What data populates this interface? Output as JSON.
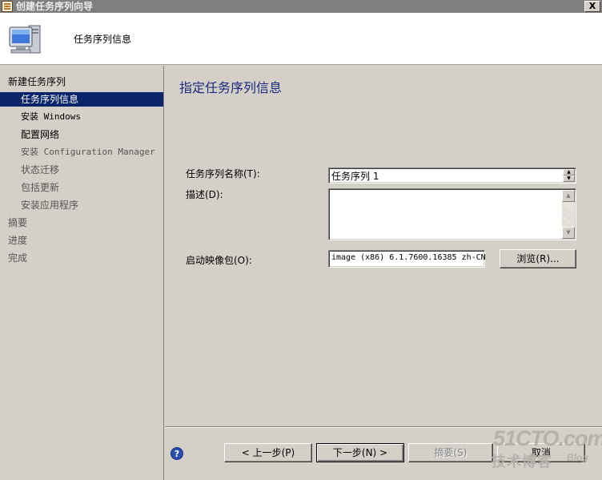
{
  "window": {
    "title": "创建任务序列向导",
    "close_glyph": "X"
  },
  "header": {
    "title": "任务序列信息"
  },
  "nav": {
    "items": [
      {
        "label": "新建任务序列"
      },
      {
        "label": "任务序列信息"
      },
      {
        "label": "安装 Windows"
      },
      {
        "label": "配置网络"
      },
      {
        "label": "安装 Configuration Manager"
      },
      {
        "label": "状态迁移"
      },
      {
        "label": "包括更新"
      },
      {
        "label": "安装应用程序"
      },
      {
        "label": "摘要"
      },
      {
        "label": "进度"
      },
      {
        "label": "完成"
      }
    ],
    "selected": "任务序列信息"
  },
  "main": {
    "page_title": "指定任务序列信息",
    "name_label": "任务序列名称(T):",
    "name_value": "任务序列 1",
    "description_label": "描述(D):",
    "description_value": "",
    "boot_image_label": "启动映像包(O):",
    "boot_image_value": "image (x86) 6.1.7600.16385 zh-CN",
    "browse_label": "浏览(R)..."
  },
  "buttons": {
    "help_glyph": "?",
    "prev_label": "< 上一步(P)",
    "next_label": "下一步(N) >",
    "summary_label": "摘要(S)",
    "cancel_label": "取消"
  },
  "watermark": {
    "main": "51CTO.com",
    "sub": "技术博客",
    "blog": "Blog"
  }
}
